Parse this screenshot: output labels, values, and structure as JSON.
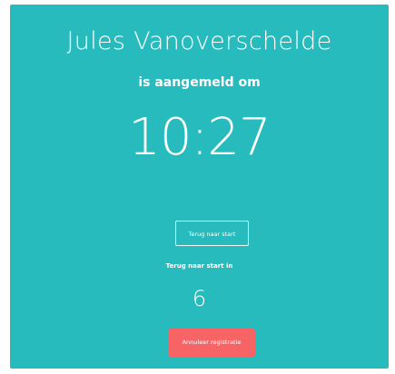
{
  "user": {
    "name": "Jules Vanoverschelde"
  },
  "status": {
    "subtitle": "is aangemeld om",
    "time": "10:27"
  },
  "actions": {
    "back_label": "Terug naar start",
    "cancel_label": "Annuleer registratie"
  },
  "countdown": {
    "label": "Terug naar start in",
    "seconds": "6"
  },
  "colors": {
    "background": "#27bbbd",
    "cancel_button": "#f76466",
    "text": "#ffffff"
  }
}
